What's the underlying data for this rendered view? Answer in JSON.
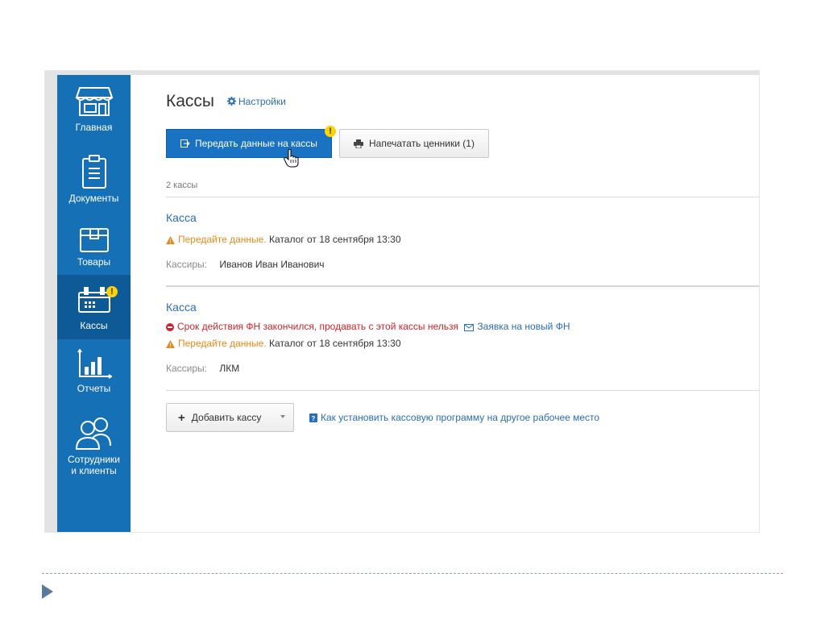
{
  "sidebar": {
    "items": [
      {
        "label": "Главная",
        "icon": "storefront-icon"
      },
      {
        "label": "Документы",
        "icon": "clipboard-icon"
      },
      {
        "label": "Товары",
        "icon": "box-icon"
      },
      {
        "label": "Кассы",
        "icon": "cash-register-icon",
        "active": true,
        "badge": "!"
      },
      {
        "label": "Отчеты",
        "icon": "bar-chart-icon"
      },
      {
        "label_line1": "Сотрудники",
        "label_line2": "и клиенты",
        "icon": "users-icon"
      }
    ]
  },
  "header": {
    "title": "Кассы",
    "settings_link": "Настройки"
  },
  "toolbar": {
    "send_button": "Передать данные на кассы",
    "send_badge": "!",
    "print_button": "Напечатать ценники (1)"
  },
  "list": {
    "count_label": "2 кассы",
    "items": [
      {
        "title": "Касса",
        "warning_link": "Передайте данные.",
        "warning_text": "Каталог от 18 сентября 13:30",
        "cashiers_label": "Кассиры:",
        "cashiers_value": "Иванов Иван Иванович"
      },
      {
        "title": "Касса",
        "error_text": "Срок действия ФН закончился, продавать с этой кассы нельзя",
        "error_link": "Заявка на новый ФН",
        "warning_link": "Передайте данные.",
        "warning_text": "Каталог от 18 сентября 13:30",
        "cashiers_label": "Кассиры:",
        "cashiers_value": "ЛКМ"
      }
    ]
  },
  "footer": {
    "add_button": "Добавить кассу",
    "help_link": "Как установить кассовую программу на другое рабочее место"
  },
  "colors": {
    "sidebar": "#1670b5",
    "sidebar_active": "#0d5a96",
    "primary_button": "#1a73c2",
    "link": "#2a6eb5",
    "warning": "#e88a1a",
    "error": "#d0232a",
    "badge": "#ffd200"
  }
}
